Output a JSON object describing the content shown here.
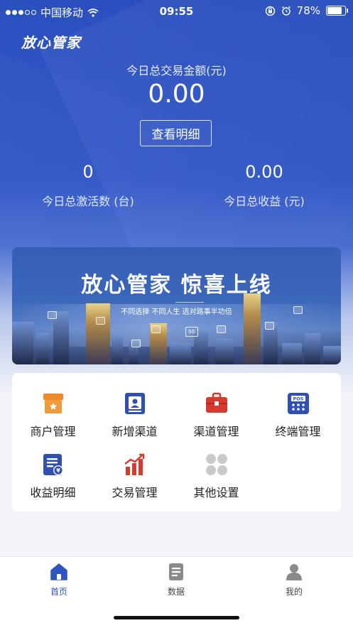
{
  "status_bar": {
    "carrier": "中国移动",
    "time": "09:55",
    "battery": "78%",
    "battery_level": 0.78
  },
  "header": {
    "brand": "放心管家",
    "total_label": "今日总交易金额(元)",
    "total_value": "0.00",
    "detail_button": "查看明细"
  },
  "stats": [
    {
      "value": "0",
      "label": "今日总激活数 (台)"
    },
    {
      "value": "0.00",
      "label": "今日总收益 (元)"
    }
  ],
  "banner": {
    "title": "放心管家 惊喜上线",
    "subtitle": "不同选择 不同人生 选对路事半功倍",
    "badge": "5G"
  },
  "menu": {
    "items": [
      {
        "label": "商户管理",
        "icon": "merchant-icon",
        "color": "#ee8a2c"
      },
      {
        "label": "新增渠道",
        "icon": "add-channel-icon",
        "color": "#2f4fb5"
      },
      {
        "label": "渠道管理",
        "icon": "briefcase-icon",
        "color": "#d63a2e"
      },
      {
        "label": "终端管理",
        "icon": "pos-terminal-icon",
        "color": "#2f4fb5",
        "icon_text": "POS"
      },
      {
        "label": "收益明细",
        "icon": "income-detail-icon",
        "color": "#2f4fb5",
        "icon_text": "¥"
      },
      {
        "label": "交易管理",
        "icon": "trade-chart-icon",
        "color": "#d63a2e"
      },
      {
        "label": "其他设置",
        "icon": "grid-settings-icon",
        "color": "#c9c9c9"
      }
    ]
  },
  "tabbar": {
    "tabs": [
      {
        "label": "首页",
        "icon": "home-icon",
        "active": true
      },
      {
        "label": "数据",
        "icon": "data-icon",
        "active": false
      },
      {
        "label": "我的",
        "icon": "profile-icon",
        "active": false
      }
    ],
    "active_color": "#2e55c2"
  }
}
